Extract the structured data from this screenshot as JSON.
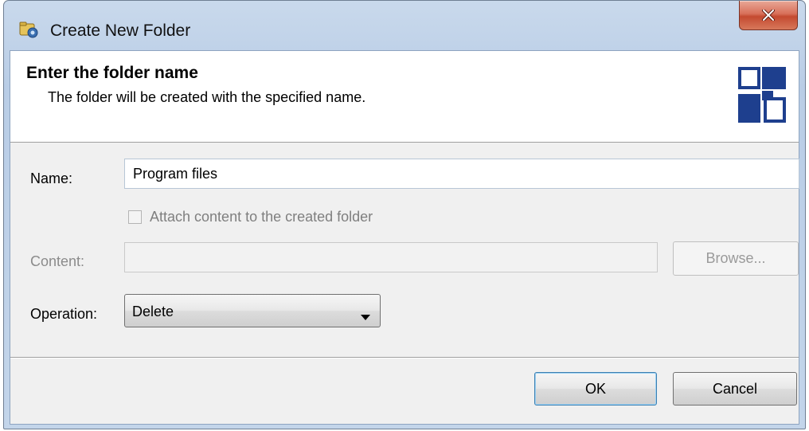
{
  "window": {
    "title": "Create New Folder"
  },
  "banner": {
    "title": "Enter the folder name",
    "subtitle": "The folder will be created with the specified name."
  },
  "form": {
    "name_label": "Name:",
    "name_value": "Program files",
    "attach_label": "Attach content to the created folder",
    "attach_checked": false,
    "content_label": "Content:",
    "content_value": "",
    "browse_label": "Browse...",
    "operation_label": "Operation:",
    "operation_value": "Delete"
  },
  "buttons": {
    "ok_label": "OK",
    "cancel_label": "Cancel"
  },
  "icons": {
    "app": "folder-app-icon",
    "close": "close-icon",
    "logo": "squares-logo-icon",
    "dropdown": "chevron-down-icon"
  },
  "colors": {
    "accent": "#1e3f8e",
    "close": "#c44a30",
    "default_button_border": "#3c7fb1"
  }
}
